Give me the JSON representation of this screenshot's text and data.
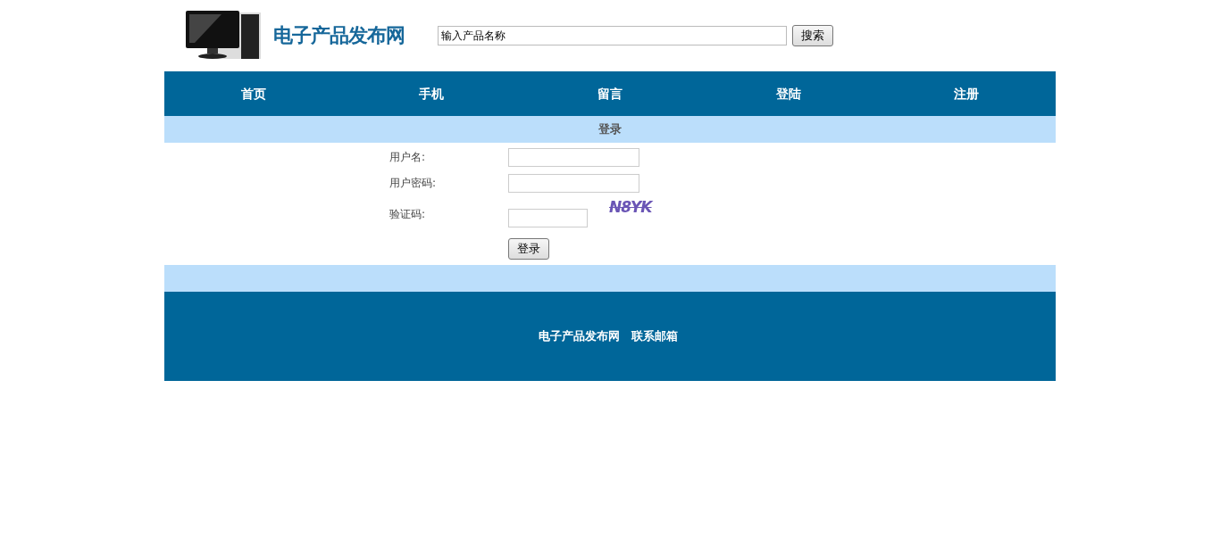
{
  "header": {
    "site_name": "电子产品发布网",
    "search": {
      "value": "输入产品名称",
      "button": "搜索"
    }
  },
  "nav": [
    {
      "label": "首页"
    },
    {
      "label": "手机"
    },
    {
      "label": "留言"
    },
    {
      "label": "登陆"
    },
    {
      "label": "注册"
    }
  ],
  "login": {
    "title": "登录",
    "fields": [
      {
        "label": "用户名:",
        "kind": "text"
      },
      {
        "label": "用户密码:",
        "kind": "password"
      },
      {
        "label": "验证码:",
        "kind": "captcha",
        "captcha": "N8YK"
      }
    ],
    "button": "登录"
  },
  "footer": {
    "site_name": "电子产品发布网",
    "contact": "联系邮箱"
  }
}
